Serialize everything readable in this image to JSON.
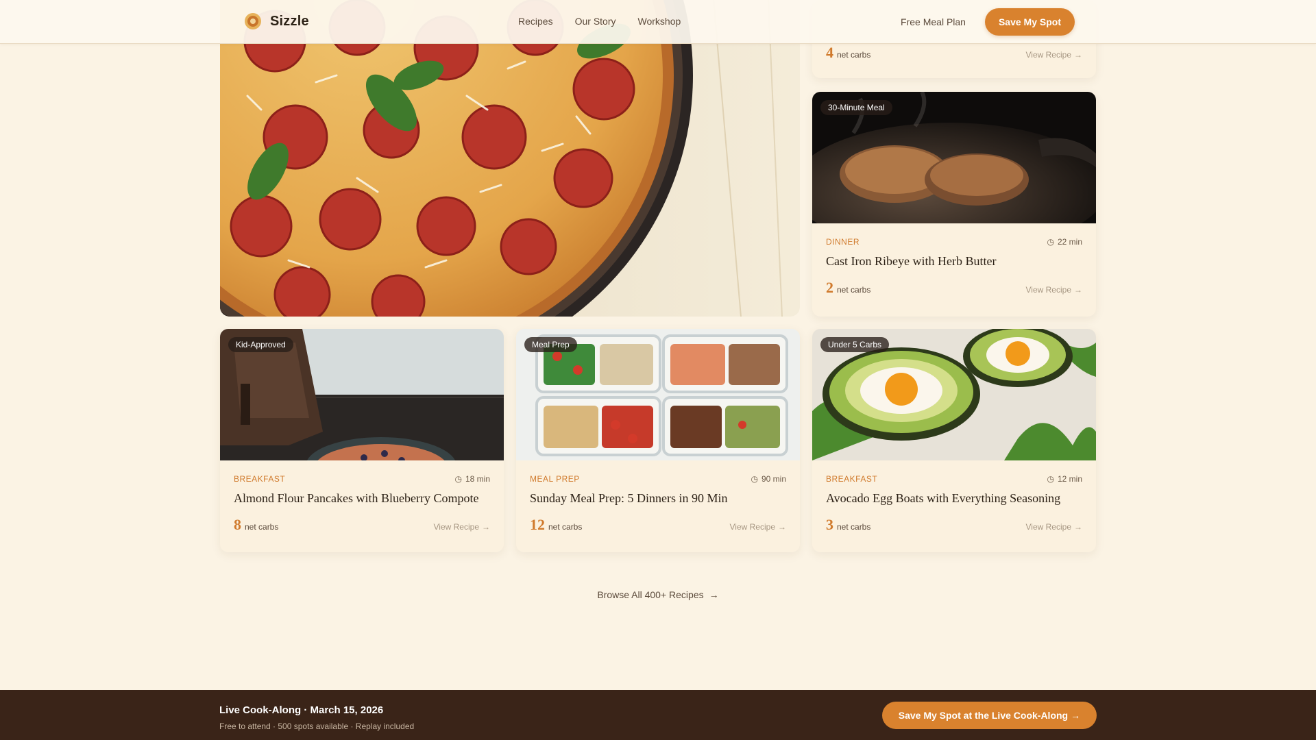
{
  "header": {
    "brand": "Sizzle",
    "nav": [
      "Recipes",
      "Our Story",
      "Workshop"
    ],
    "meal_plan_link": "Free Meal Plan",
    "cta": "Save My Spot"
  },
  "partial_card": {
    "carbs": "4",
    "carbs_label": "net carbs",
    "view_link": "View Recipe"
  },
  "cards": [
    {
      "badge": "30-Minute Meal",
      "category": "DINNER",
      "time": "22 min",
      "title": "Cast Iron Ribeye with Herb Butter",
      "carbs": "2",
      "carbs_label": "net carbs",
      "view_link": "View Recipe",
      "image": "steak-in-skillet"
    },
    {
      "badge": "Kid-Approved",
      "category": "BREAKFAST",
      "time": "18 min",
      "title": "Almond Flour Pancakes with Blueberry Compote",
      "carbs": "8",
      "carbs_label": "net carbs",
      "view_link": "View Recipe",
      "image": "lunchbox-and-bowl"
    },
    {
      "badge": "Meal Prep",
      "category": "MEAL PREP",
      "time": "90 min",
      "title": "Sunday Meal Prep: 5 Dinners in 90 Min",
      "carbs": "12",
      "carbs_label": "net carbs",
      "view_link": "View Recipe",
      "image": "meal-prep-containers"
    },
    {
      "badge": "Under 5 Carbs",
      "category": "BREAKFAST",
      "time": "12 min",
      "title": "Avocado Egg Boats with Everything Seasoning",
      "carbs": "3",
      "carbs_label": "net carbs",
      "view_link": "View Recipe",
      "image": "avocado-egg-boats"
    }
  ],
  "featured_image": "pepperoni-pizza",
  "browse_link": "Browse All 400+ Recipes",
  "banner": {
    "title": "Live Cook-Along · March 15, 2026",
    "subtitle": "Free to attend · 500 spots available · Replay included",
    "cta": "Save My Spot at the Live Cook-Along →"
  },
  "colors": {
    "background": "#fbf3e4",
    "accent": "#d9822e",
    "banner": "#3a2418",
    "category": "#d07a2c"
  }
}
